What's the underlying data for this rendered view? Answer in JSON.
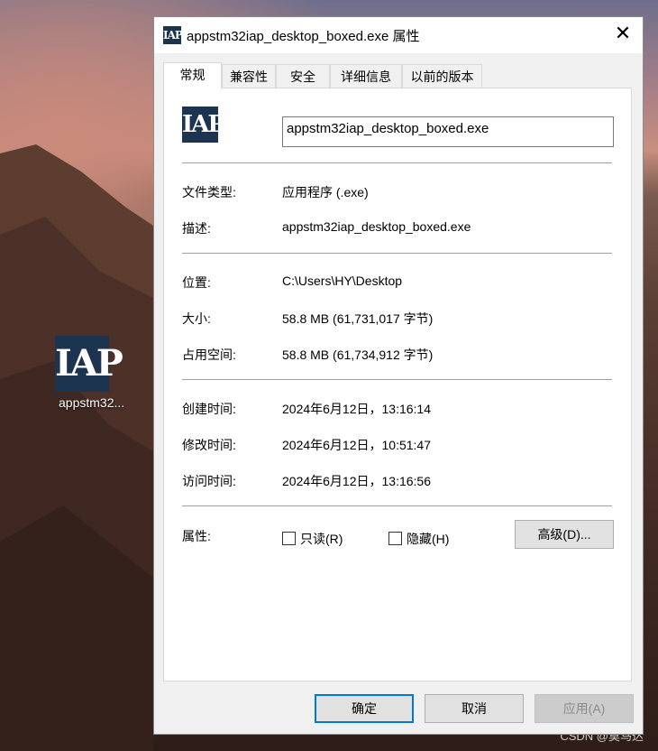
{
  "desktop": {
    "icon_text": "IAP",
    "icon_label": "appstm32..."
  },
  "window": {
    "title": "appstm32iap_desktop_boxed.exe 属性",
    "icon_text": "IAP",
    "close": "✕"
  },
  "tabs": [
    "常规",
    "兼容性",
    "安全",
    "详细信息",
    "以前的版本"
  ],
  "general": {
    "icon_text": "IAP",
    "file_name": "appstm32iap_desktop_boxed.exe",
    "rows": [
      {
        "label": "文件类型:",
        "value": "应用程序 (.exe)"
      },
      {
        "label": "描述:",
        "value": "appstm32iap_desktop_boxed.exe"
      },
      {
        "label": "位置:",
        "value": "C:\\Users\\HY\\Desktop"
      },
      {
        "label": "大小:",
        "value": "58.8 MB (61,731,017 字节)"
      },
      {
        "label": "占用空间:",
        "value": "58.8 MB (61,734,912 字节)"
      },
      {
        "label": "创建时间:",
        "value": "2024年6月12日，13:16:14"
      },
      {
        "label": "修改时间:",
        "value": "2024年6月12日，10:51:47"
      },
      {
        "label": "访问时间:",
        "value": "2024年6月12日，13:16:56"
      }
    ],
    "attributes_label": "属性:",
    "readonly_label": "只读(R)",
    "readonly_checked": false,
    "hidden_label": "隐藏(H)",
    "hidden_checked": false,
    "advanced_label": "高级(D)..."
  },
  "buttons": {
    "ok": "确定",
    "cancel": "取消",
    "apply": "应用(A)"
  },
  "watermark": "CSDN @莫马达"
}
